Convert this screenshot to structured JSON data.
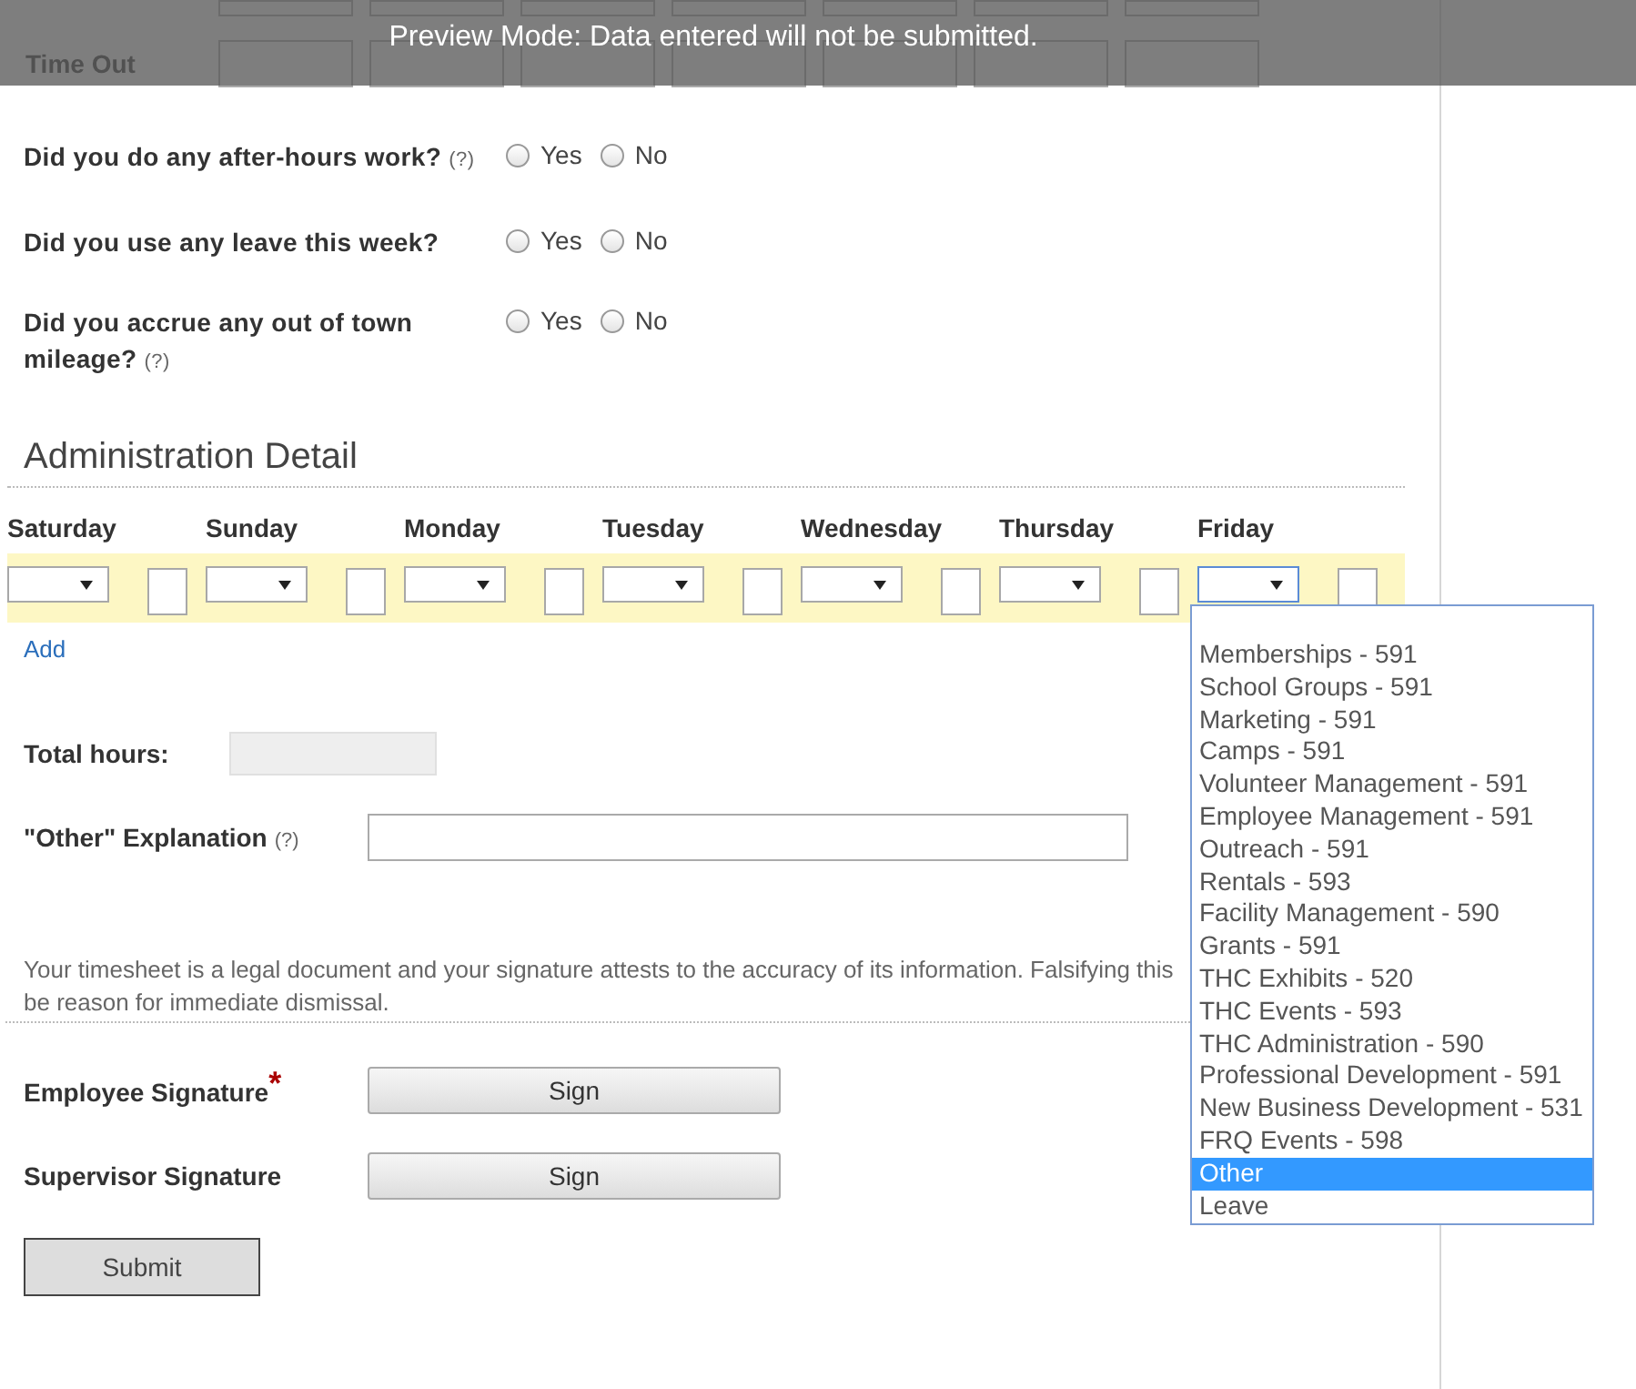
{
  "banner": {
    "text": "Preview Mode: Data entered will not be submitted."
  },
  "time_out": {
    "label": "Time Out"
  },
  "questions": [
    {
      "label": "Did you do any after-hours work?",
      "help": "(?)",
      "options": [
        {
          "label": "Yes",
          "checked": false
        },
        {
          "label": "No",
          "checked": false
        }
      ]
    },
    {
      "label": "Did you use any leave this week?",
      "options": [
        {
          "label": "Yes",
          "checked": false
        },
        {
          "label": "No",
          "checked": false
        }
      ]
    },
    {
      "label": "Did you accrue any out of town mileage?",
      "help": "(?)",
      "options": [
        {
          "label": "Yes",
          "checked": false
        },
        {
          "label": "No",
          "checked": false
        }
      ]
    }
  ],
  "admin": {
    "title": "Administration Detail",
    "add_link": "Add",
    "days": [
      {
        "name": "Saturday",
        "open": false
      },
      {
        "name": "Sunday",
        "open": false
      },
      {
        "name": "Monday",
        "open": false
      },
      {
        "name": "Tuesday",
        "open": false
      },
      {
        "name": "Wednesday",
        "open": false
      },
      {
        "name": "Thursday",
        "open": false
      },
      {
        "name": "Friday",
        "open": true
      }
    ],
    "dropdown_options": [
      {
        "label": "Memberships - 591",
        "selected": false
      },
      {
        "label": "School Groups - 591",
        "selected": false
      },
      {
        "label": "Marketing - 591",
        "selected": false
      },
      {
        "label": "Camps - 591",
        "selected": false
      },
      {
        "label": "Volunteer Management - 591",
        "selected": false
      },
      {
        "label": "Employee Management - 591",
        "selected": false
      },
      {
        "label": "Outreach - 591",
        "selected": false
      },
      {
        "label": "Rentals - 593",
        "selected": false
      },
      {
        "label": "Facility Management - 590",
        "selected": false
      },
      {
        "label": "Grants - 591",
        "selected": false
      },
      {
        "label": "THC Exhibits - 520",
        "selected": false
      },
      {
        "label": "THC Events - 593",
        "selected": false
      },
      {
        "label": "THC Administration - 590",
        "selected": false
      },
      {
        "label": "Professional Development - 591",
        "selected": false
      },
      {
        "label": "New Business Development - 531",
        "selected": false
      },
      {
        "label": "FRQ Events - 598",
        "selected": false
      },
      {
        "label": "Other",
        "selected": true
      },
      {
        "label": "Leave",
        "selected": false
      }
    ]
  },
  "total_hours": {
    "label": "Total hours:"
  },
  "other_explanation": {
    "label": "\"Other\" Explanation",
    "help": "(?)"
  },
  "disclaimer": {
    "lines": [
      "Your timesheet is a legal document and your signature attests to the accuracy of its information. Falsifying this",
      "be reason for immediate dismissal."
    ]
  },
  "signatures": [
    {
      "label": "Employee Signature",
      "required_mark": "*",
      "button": "Sign"
    },
    {
      "label": "Supervisor Signature",
      "button": "Sign"
    }
  ],
  "submit": "Submit"
}
